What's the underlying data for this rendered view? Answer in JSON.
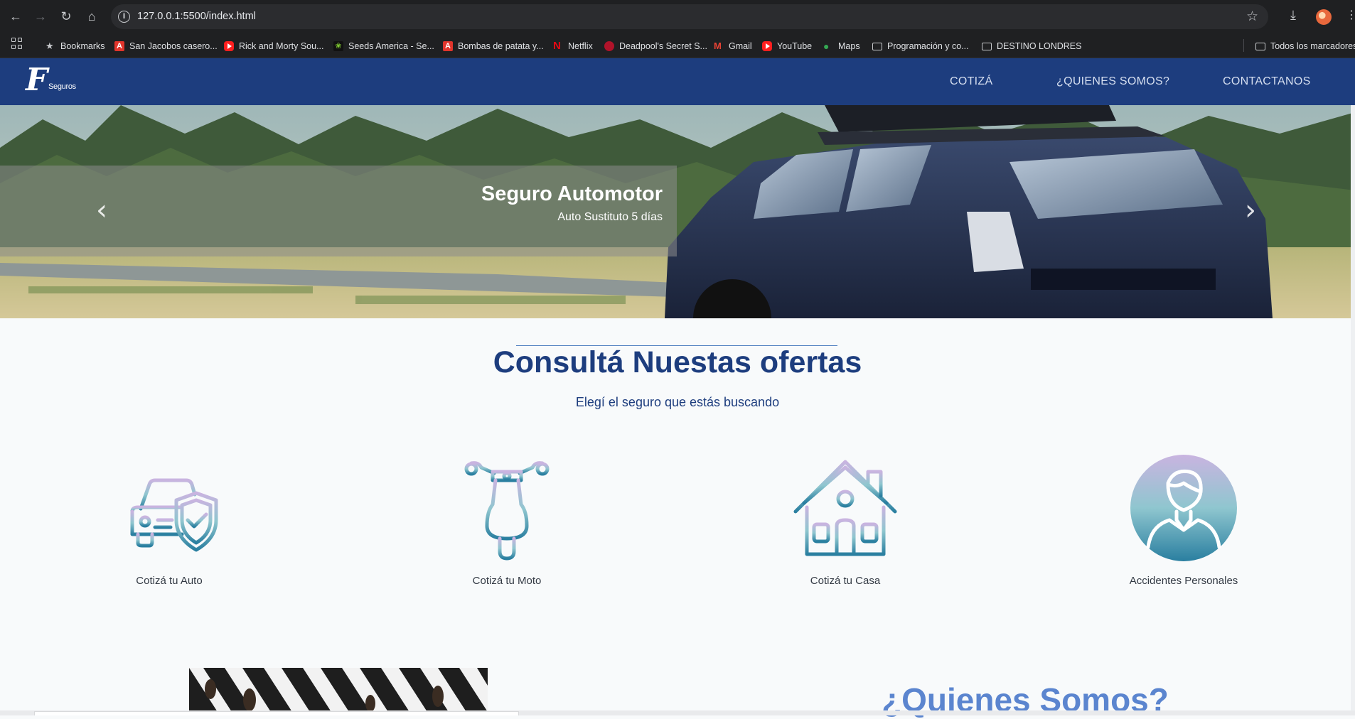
{
  "browser": {
    "url": "127.0.0.1:5500/index.html",
    "bookmarks": [
      {
        "label": "Bookmarks",
        "icon": "star-icon"
      },
      {
        "label": "San Jacobos casero...",
        "icon": "acrobat-icon"
      },
      {
        "label": "Rick and Morty Sou...",
        "icon": "youtube-icon"
      },
      {
        "label": "Seeds America - Se...",
        "icon": "seeds-icon"
      },
      {
        "label": "Bombas de patata y...",
        "icon": "acrobat-icon"
      },
      {
        "label": "Netflix",
        "icon": "netflix-icon"
      },
      {
        "label": "Deadpool's Secret S...",
        "icon": "deadpool-icon"
      },
      {
        "label": "Gmail",
        "icon": "gmail-icon"
      },
      {
        "label": "YouTube",
        "icon": "youtube-icon"
      },
      {
        "label": "Maps",
        "icon": "maps-icon"
      },
      {
        "label": "Programación y co...",
        "icon": "folder-icon"
      },
      {
        "label": "DESTINO LONDRES",
        "icon": "folder-icon"
      }
    ],
    "all_bookmarks": "Todos los marcadores"
  },
  "site": {
    "logo_letter": "F",
    "logo_text": "Seguros",
    "nav": [
      "COTIZÁ",
      "¿QUIENES SOMOS?",
      "CONTACTANOS"
    ],
    "brand_color": "#1d3d7e"
  },
  "hero": {
    "title": "Seguro Automotor",
    "subtitle": "Auto Sustituto 5 días",
    "prev_icon": "chevron-left-icon",
    "next_icon": "chevron-right-icon"
  },
  "offers": {
    "title": "Consultá Nuestas ofertas",
    "subtitle": "Elegí el seguro que estás buscando",
    "cards": [
      {
        "label": "Cotizá tu Auto",
        "icon": "car-shield-icon"
      },
      {
        "label": "Cotizá tu Moto",
        "icon": "scooter-icon"
      },
      {
        "label": "Cotizá tu Casa",
        "icon": "house-icon"
      },
      {
        "label": "Accidentes Personales",
        "icon": "person-icon"
      }
    ]
  },
  "about": {
    "title": "¿Quienes Somos?"
  }
}
